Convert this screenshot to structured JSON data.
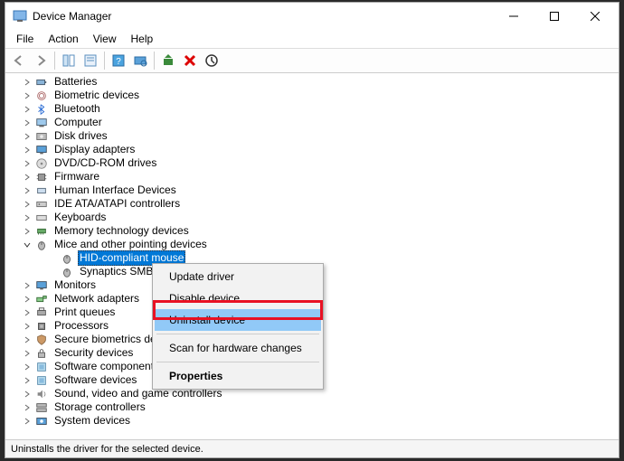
{
  "window": {
    "title": "Device Manager"
  },
  "menubar": {
    "items": [
      "File",
      "Action",
      "View",
      "Help"
    ]
  },
  "tree": {
    "root_icon": "computer",
    "categories": [
      {
        "label": "Batteries",
        "icon": "battery"
      },
      {
        "label": "Biometric devices",
        "icon": "fingerprint"
      },
      {
        "label": "Bluetooth",
        "icon": "bluetooth"
      },
      {
        "label": "Computer",
        "icon": "computer"
      },
      {
        "label": "Disk drives",
        "icon": "disk"
      },
      {
        "label": "Display adapters",
        "icon": "display"
      },
      {
        "label": "DVD/CD-ROM drives",
        "icon": "cd"
      },
      {
        "label": "Firmware",
        "icon": "chip"
      },
      {
        "label": "Human Interface Devices",
        "icon": "hid"
      },
      {
        "label": "IDE ATA/ATAPI controllers",
        "icon": "ide"
      },
      {
        "label": "Keyboards",
        "icon": "keyboard"
      },
      {
        "label": "Memory technology devices",
        "icon": "memory"
      },
      {
        "label": "Mice and other pointing devices",
        "icon": "mouse",
        "expanded": true,
        "children": [
          {
            "label": "HID-compliant mouse",
            "icon": "mouse",
            "selected": true
          },
          {
            "label": "Synaptics SMBus TouchPad",
            "icon": "mouse"
          }
        ]
      },
      {
        "label": "Monitors",
        "icon": "monitor"
      },
      {
        "label": "Network adapters",
        "icon": "network"
      },
      {
        "label": "Print queues",
        "icon": "printer"
      },
      {
        "label": "Processors",
        "icon": "cpu"
      },
      {
        "label": "Secure biometrics devices",
        "icon": "secure"
      },
      {
        "label": "Security devices",
        "icon": "security"
      },
      {
        "label": "Software components",
        "icon": "software"
      },
      {
        "label": "Software devices",
        "icon": "software"
      },
      {
        "label": "Sound, video and game controllers",
        "icon": "sound"
      },
      {
        "label": "Storage controllers",
        "icon": "storage"
      },
      {
        "label": "System devices",
        "icon": "system"
      }
    ]
  },
  "context_menu": {
    "items": [
      {
        "label": "Update driver"
      },
      {
        "label": "Disable device"
      },
      {
        "label": "Uninstall device",
        "highlighted": true,
        "annotated": true
      },
      {
        "sep": true
      },
      {
        "label": "Scan for hardware changes"
      },
      {
        "sep": true
      },
      {
        "label": "Properties",
        "bold": true
      }
    ]
  },
  "statusbar": {
    "text": "Uninstalls the driver for the selected device."
  }
}
